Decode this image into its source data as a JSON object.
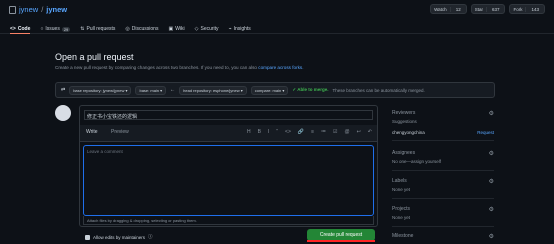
{
  "repo": {
    "owner": "jynew",
    "name": "jynew"
  },
  "actions": {
    "watch": "Watch",
    "watch_count": "12",
    "star": "Star",
    "star_count": "637",
    "fork": "Fork",
    "fork_count": "143"
  },
  "tabs": [
    {
      "label": "Code"
    },
    {
      "label": "Issues",
      "badge": "29"
    },
    {
      "label": "Pull requests"
    },
    {
      "label": "Discussions"
    },
    {
      "label": "Wiki"
    },
    {
      "label": "Security"
    },
    {
      "label": "Insights"
    }
  ],
  "page": {
    "title": "Open a pull request",
    "subtitle": "Create a new pull request by comparing changes across two branches. If you need to, you can also",
    "compare_link": "compare across forks."
  },
  "compare": {
    "base_repo": "base repository: jynew/jynew ▾",
    "base": "base: main ▾",
    "head_repo": "head repository: esphone/jynew ▾",
    "compare": "compare: main ▾",
    "able": "✓ Able to merge.",
    "merge_text": "These branches can be automatically merged."
  },
  "editor": {
    "title_value": "修正书小宝铁还的逻辑",
    "write": "Write",
    "preview": "Preview",
    "comment_placeholder": "Leave a comment",
    "attach": "Attach files by dragging & dropping, selecting or pasting them."
  },
  "toolbar": [
    "H",
    "B",
    "I",
    "“",
    "<>",
    "🔗",
    "≡",
    "≔",
    "☑",
    "@",
    "↩",
    "↶"
  ],
  "bottom": {
    "allow": "Allow edits by maintainers",
    "create": "Create pull request"
  },
  "sidebar": {
    "reviewers": {
      "title": "Reviewers",
      "suggestions": "Suggestions",
      "user": "chengyongchina",
      "request": "Request"
    },
    "assignees": {
      "title": "Assignees",
      "value": "No one—assign yourself"
    },
    "labels": {
      "title": "Labels",
      "value": "None yet"
    },
    "projects": {
      "title": "Projects",
      "value": "None yet"
    },
    "milestone": {
      "title": "Milestone"
    }
  }
}
